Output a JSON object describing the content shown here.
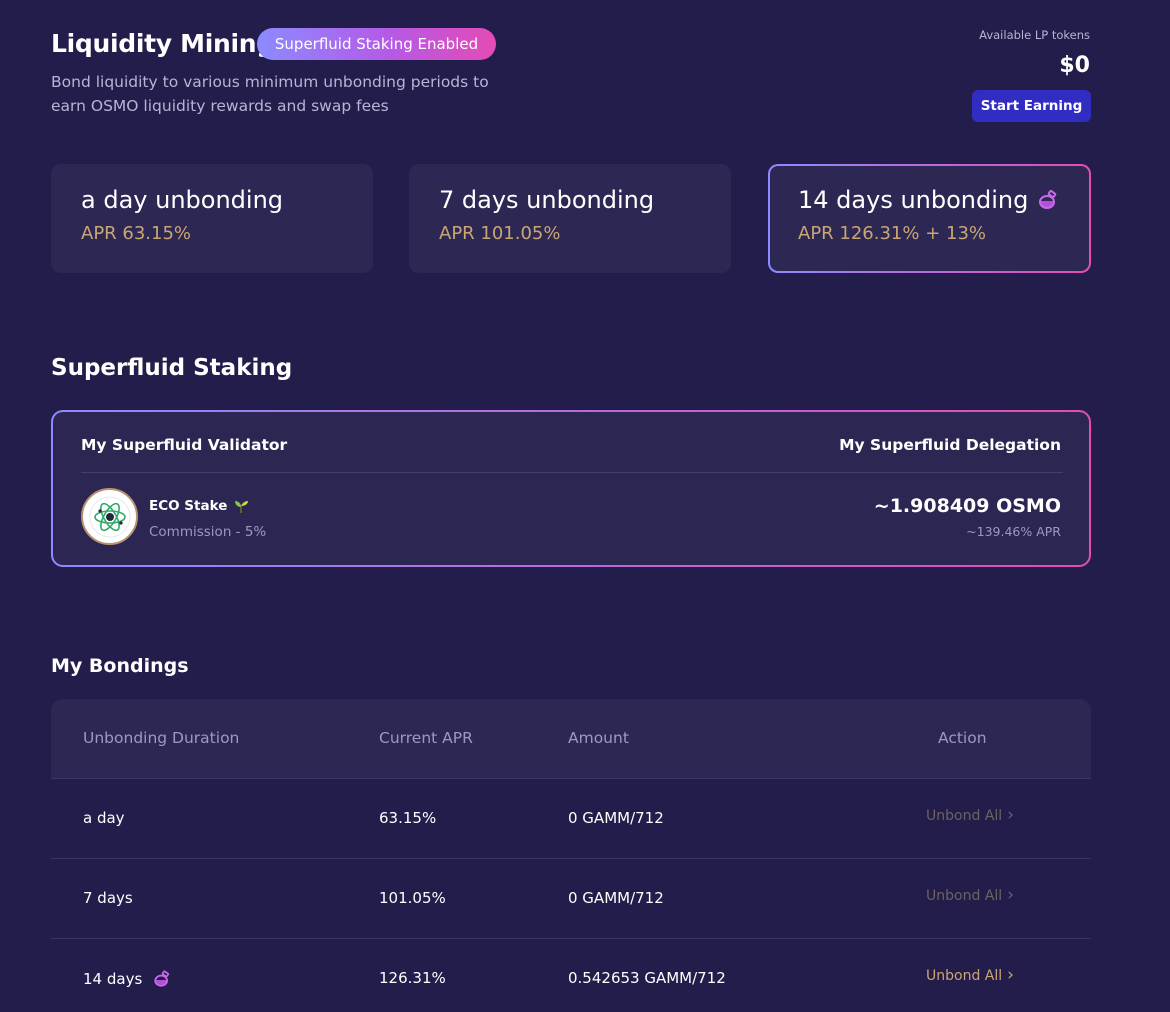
{
  "header": {
    "title": "Liquidity Mining",
    "badge": "Superfluid Staking Enabled",
    "subtitle": "Bond liquidity to various minimum unbonding periods to earn OSMO liquidity rewards and swap fees",
    "lp_label": "Available LP tokens",
    "lp_value": "$0",
    "start_button": "Start Earning"
  },
  "cards": [
    {
      "title": "a day unbonding",
      "apr": "APR 63.15%",
      "selected": false
    },
    {
      "title": "7 days unbonding",
      "apr": "APR 101.05%",
      "selected": false
    },
    {
      "title": "14 days unbonding",
      "apr": "APR 126.31% + 13%",
      "selected": true,
      "icon": "potion-icon"
    }
  ],
  "superfluid": {
    "title": "Superfluid Staking",
    "validator_header": "My Superfluid Validator",
    "delegation_header": "My Superfluid Delegation",
    "validator_name": "ECO Stake",
    "validator_icon": "sprout-icon",
    "commission": "Commission - 5%",
    "delegation_amount": "~1.908409 OSMO",
    "delegation_apr": "~139.46% APR"
  },
  "bondings": {
    "title": "My Bondings",
    "columns": [
      "Unbonding Duration",
      "Current APR",
      "Amount",
      "Action"
    ],
    "rows": [
      {
        "duration": "a day",
        "apr": "63.15%",
        "amount": "0 GAMM/712",
        "action": "Unbond All",
        "active": false
      },
      {
        "duration": "7 days",
        "apr": "101.05%",
        "amount": "0 GAMM/712",
        "action": "Unbond All",
        "active": false
      },
      {
        "duration": "14 days",
        "apr": "126.31%",
        "amount": "0.542653 GAMM/712",
        "action": "Unbond All",
        "active": true
      }
    ]
  },
  "colors": {
    "background": "#231d4b",
    "card": "#2d2853",
    "apr_gold": "#c9a673",
    "accent_button": "#322dc2",
    "gradient_start": "#8c8bff",
    "gradient_end": "#e54bb5"
  }
}
